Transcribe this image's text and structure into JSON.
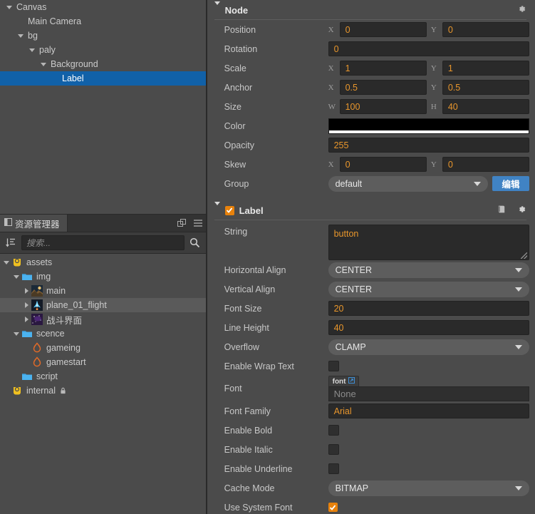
{
  "hierarchy": {
    "nodes": [
      {
        "label": "Canvas",
        "indent": 0,
        "toggle": "down",
        "selected": false
      },
      {
        "label": "Main Camera",
        "indent": 1,
        "toggle": "none",
        "selected": false
      },
      {
        "label": "bg",
        "indent": 1,
        "toggle": "down",
        "selected": false
      },
      {
        "label": "paly",
        "indent": 2,
        "toggle": "down",
        "selected": false
      },
      {
        "label": "Background",
        "indent": 3,
        "toggle": "down",
        "selected": false
      },
      {
        "label": "Label",
        "indent": 4,
        "toggle": "none",
        "selected": true
      }
    ],
    "selection_color": "#1161a8"
  },
  "assets": {
    "tab_title": "资源管理器",
    "tab_icon": "panel-icon",
    "float_icon": "float-window-icon",
    "menu_icon": "hamburger-menu-icon",
    "sort_icon": "sort-icon",
    "search_placeholder": "搜索...",
    "search_value": "",
    "search_icon": "search-icon",
    "tree": [
      {
        "label": "assets",
        "indent": 0,
        "toggle": "down",
        "icon": "db-assets-icon",
        "highlight": false,
        "locked": false
      },
      {
        "label": "img",
        "indent": 1,
        "toggle": "down",
        "icon": "folder-icon",
        "highlight": false,
        "locked": false
      },
      {
        "label": "main",
        "indent": 2,
        "toggle": "right",
        "icon": "texture-main-icon",
        "highlight": false,
        "locked": false
      },
      {
        "label": "plane_01_flight",
        "indent": 2,
        "toggle": "right",
        "icon": "texture-plane-icon",
        "highlight": true,
        "locked": false
      },
      {
        "label": "战斗界面",
        "indent": 2,
        "toggle": "right",
        "icon": "texture-battle-icon",
        "highlight": false,
        "locked": false
      },
      {
        "label": "scence",
        "indent": 1,
        "toggle": "down",
        "icon": "folder-icon",
        "highlight": false,
        "locked": false
      },
      {
        "label": "gameing",
        "indent": 2,
        "toggle": "none",
        "icon": "scene-fire-icon",
        "highlight": false,
        "locked": false
      },
      {
        "label": "gamestart",
        "indent": 2,
        "toggle": "none",
        "icon": "scene-fire-icon",
        "highlight": false,
        "locked": false
      },
      {
        "label": "script",
        "indent": 1,
        "toggle": "none",
        "icon": "folder-icon",
        "highlight": false,
        "locked": false
      },
      {
        "label": "internal",
        "indent": 0,
        "toggle": "none",
        "icon": "db-internal-icon",
        "highlight": false,
        "locked": true
      }
    ]
  },
  "inspector": {
    "node_section": {
      "title": "Node",
      "collapse_icon": "triangle-down-icon",
      "gear_icon": "gear-icon",
      "position": {
        "label": "Position",
        "x_axis": "X",
        "x": "0",
        "y_axis": "Y",
        "y": "0"
      },
      "rotation": {
        "label": "Rotation",
        "value": "0"
      },
      "scale": {
        "label": "Scale",
        "x_axis": "X",
        "x": "1",
        "y_axis": "Y",
        "y": "1"
      },
      "anchor": {
        "label": "Anchor",
        "x_axis": "X",
        "x": "0.5",
        "y_axis": "Y",
        "y": "0.5"
      },
      "size": {
        "label": "Size",
        "w_axis": "W",
        "w": "100",
        "h_axis": "H",
        "h": "40"
      },
      "color": {
        "label": "Color",
        "value": "#000000",
        "alpha_color": "#ffffff"
      },
      "opacity": {
        "label": "Opacity",
        "value": "255"
      },
      "skew": {
        "label": "Skew",
        "x_axis": "X",
        "x": "0",
        "y_axis": "Y",
        "y": "0"
      },
      "group": {
        "label": "Group",
        "value": "default",
        "edit_button": "编辑"
      }
    },
    "label_section": {
      "title": "Label",
      "enabled": true,
      "collapse_icon": "triangle-down-icon",
      "help_icon": "book-help-icon",
      "gear_icon": "gear-icon",
      "string": {
        "label": "String",
        "value": "button"
      },
      "horizontal": {
        "label": "Horizontal Align",
        "value": "CENTER"
      },
      "vertical": {
        "label": "Vertical Align",
        "value": "CENTER"
      },
      "font_size": {
        "label": "Font Size",
        "value": "20"
      },
      "line_height": {
        "label": "Line Height",
        "value": "40"
      },
      "overflow": {
        "label": "Overflow",
        "value": "CLAMP"
      },
      "wrap_text": {
        "label": "Enable Wrap Text",
        "checked": false
      },
      "font": {
        "label": "Font",
        "badge": "font",
        "value": "None"
      },
      "font_family": {
        "label": "Font Family",
        "value": "Arial"
      },
      "bold": {
        "label": "Enable Bold",
        "checked": false
      },
      "italic": {
        "label": "Enable Italic",
        "checked": false
      },
      "underline": {
        "label": "Enable Underline",
        "checked": false
      },
      "cache_mode": {
        "label": "Cache Mode",
        "value": "BITMAP"
      },
      "system_font": {
        "label": "Use System Font",
        "checked": true
      }
    }
  },
  "colors": {
    "accent_orange": "#e8962c",
    "selection_blue": "#1161a8",
    "button_blue": "#4083c4",
    "panel_bg": "#4b4b4b"
  }
}
